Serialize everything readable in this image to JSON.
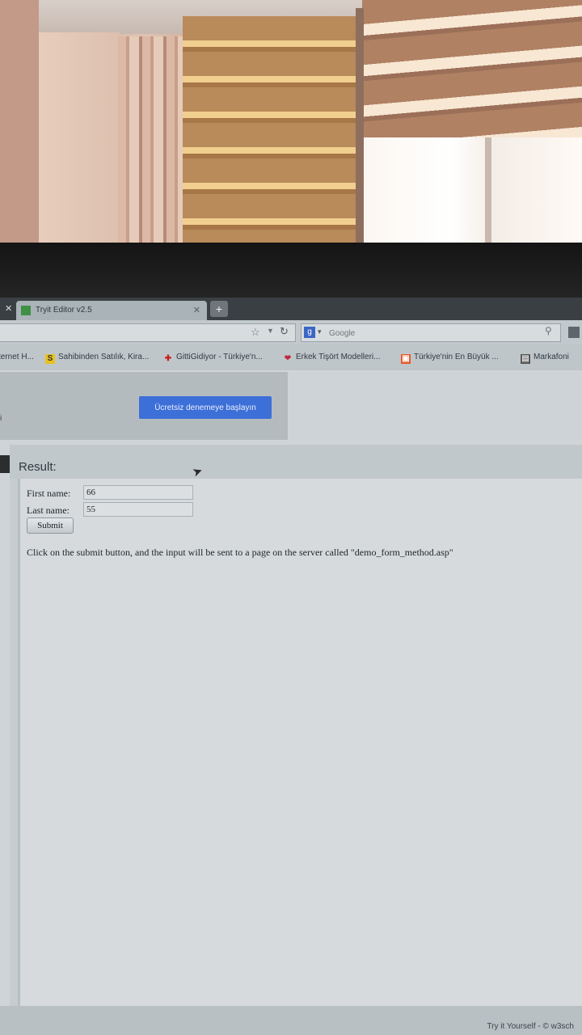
{
  "browser": {
    "tab": {
      "title": "Tryit Editor v2.5"
    },
    "search": {
      "placeholder": "Google"
    },
    "bookmarks": [
      "ternet H...",
      "Sahibinden Satılık, Kira...",
      "GittiGidiyor - Türkiye'n...",
      "Erkek Tişört Modelleri...",
      "Türkiye'nin En Büyük ...",
      "Markafoni"
    ]
  },
  "ad": {
    "fragment": "i",
    "button_label": "Ücretsiz denemeye başlayın"
  },
  "result": {
    "heading": "Result:",
    "first_name_label": "First name:",
    "first_name_value": "66",
    "last_name_label": "Last name:",
    "last_name_value": "55",
    "submit_label": "Submit",
    "hint": "Click on the submit button, and the input will be sent to a page on the server called \"demo_form_method.asp\""
  },
  "footer": {
    "text": "Try it Yourself - © w3sch"
  }
}
